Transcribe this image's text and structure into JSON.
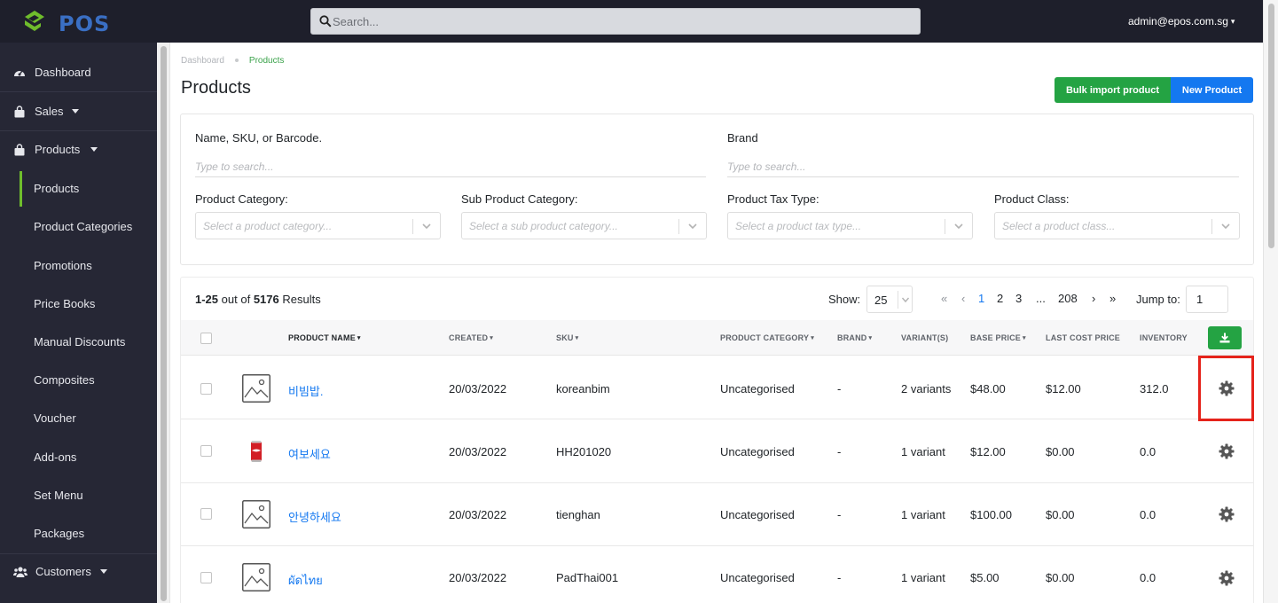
{
  "app": {
    "logo_text": "POS",
    "search_placeholder": "Search...",
    "user_email": "admin@epos.com.sg"
  },
  "sidebar": {
    "items": [
      {
        "label": "Dashboard",
        "icon": "dashboard-icon"
      },
      {
        "label": "Sales",
        "icon": "shopping-bag-icon",
        "has_caret": true
      },
      {
        "label": "Products",
        "icon": "shopping-bag-icon",
        "has_caret": true,
        "expanded": true
      },
      {
        "label": "Customers",
        "icon": "users-icon",
        "has_caret": true
      }
    ],
    "product_subitems": [
      {
        "label": "Products",
        "active": true
      },
      {
        "label": "Product Categories"
      },
      {
        "label": "Promotions"
      },
      {
        "label": "Price Books"
      },
      {
        "label": "Manual Discounts"
      },
      {
        "label": "Composites"
      },
      {
        "label": "Voucher"
      },
      {
        "label": "Add-ons"
      },
      {
        "label": "Set Menu"
      },
      {
        "label": "Packages"
      }
    ]
  },
  "breadcrumb": {
    "parent": "Dashboard",
    "current": "Products"
  },
  "page": {
    "title": "Products",
    "bulk_import_label": "Bulk import product",
    "new_product_label": "New Product"
  },
  "filters": {
    "name_label": "Name, SKU, or Barcode.",
    "name_placeholder": "Type to search...",
    "brand_label": "Brand",
    "brand_placeholder": "Type to search...",
    "category_label": "Product Category:",
    "category_placeholder": "Select a product category...",
    "sub_category_label": "Sub Product Category:",
    "sub_category_placeholder": "Select a sub product category...",
    "tax_type_label": "Product Tax Type:",
    "tax_type_placeholder": "Select a product tax type...",
    "class_label": "Product Class:",
    "class_placeholder": "Select a product class..."
  },
  "results": {
    "range": "1-25",
    "out_of": "out of",
    "total": "5176",
    "suffix": "Results",
    "show_label": "Show:",
    "show_value": "25",
    "pagination": {
      "first": "«",
      "prev": "‹",
      "pages": [
        "1",
        "2",
        "3"
      ],
      "ellipsis": "...",
      "last_page": "208",
      "next": "›",
      "last": "»",
      "current": "1"
    },
    "jump_label": "Jump to:",
    "jump_value": "1"
  },
  "table": {
    "columns": {
      "name": "PRODUCT NAME",
      "created": "CREATED",
      "sku": "SKU",
      "category": "PRODUCT CATEGORY",
      "brand": "BRAND",
      "variants": "VARIANT(S)",
      "base_price": "BASE PRICE",
      "last_cost": "LAST COST PRICE",
      "inventory": "INVENTORY"
    },
    "rows": [
      {
        "name": "비빔밥.",
        "created": "20/03/2022",
        "sku": "koreanbim",
        "category": "Uncategorised",
        "brand": "-",
        "variants": "2 variants",
        "base_price": "$48.00",
        "last_cost": "$12.00",
        "inventory": "312.0",
        "image": "placeholder"
      },
      {
        "name": "여보세요",
        "created": "20/03/2022",
        "sku": "HH201020",
        "category": "Uncategorised",
        "brand": "-",
        "variants": "1 variant",
        "base_price": "$12.00",
        "last_cost": "$0.00",
        "inventory": "0.0",
        "image": "can"
      },
      {
        "name": "안녕하세요",
        "created": "20/03/2022",
        "sku": "tienghan",
        "category": "Uncategorised",
        "brand": "-",
        "variants": "1 variant",
        "base_price": "$100.00",
        "last_cost": "$0.00",
        "inventory": "0.0",
        "image": "placeholder"
      },
      {
        "name": "ผัดไทย",
        "created": "20/03/2022",
        "sku": "PadThai001",
        "category": "Uncategorised",
        "brand": "-",
        "variants": "1 variant",
        "base_price": "$5.00",
        "last_cost": "$0.00",
        "inventory": "0.0",
        "image": "placeholder"
      }
    ]
  },
  "colors": {
    "topbar": "#1e1f2b",
    "sidebar": "#262735",
    "accent_green": "#24a343",
    "accent_blue": "#1478f0",
    "highlight_red": "#e5231b"
  }
}
